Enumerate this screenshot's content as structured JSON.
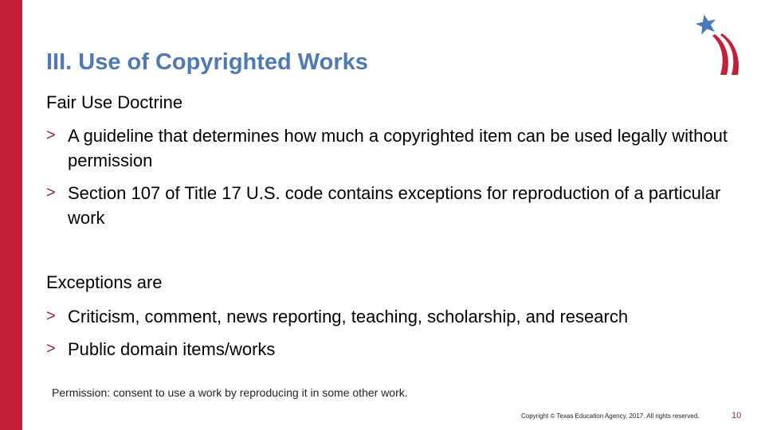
{
  "slide": {
    "title": "III. Use of Copyrighted Works",
    "sections": [
      {
        "heading": "Fair Use Doctrine",
        "bullets": [
          "A guideline that determines how much a copyrighted item can be used legally without permission",
          "Section 107 of Title 17 U.S. code contains exceptions for reproduction of a particular work"
        ]
      },
      {
        "heading": "Exceptions are",
        "bullets": [
          "Criticism, comment, news reporting, teaching, scholarship, and research",
          "Public domain items/works"
        ]
      }
    ],
    "note": "Permission: consent to use a work by reproducing it in some other work.",
    "bullet_glyph": ">",
    "bullet_icon": "chevron-right-icon",
    "logo_icon": "star-with-stripes-logo-icon"
  },
  "footer": {
    "copyright": "Copyright © Texas Education Agency, 2017. All rights reserved.",
    "page_number": "10"
  },
  "colors": {
    "accent_red": "#c2203a",
    "title_blue": "#4f79b3",
    "bullet_maroon": "#8b2b3a",
    "star_blue": "#4a78b8"
  }
}
